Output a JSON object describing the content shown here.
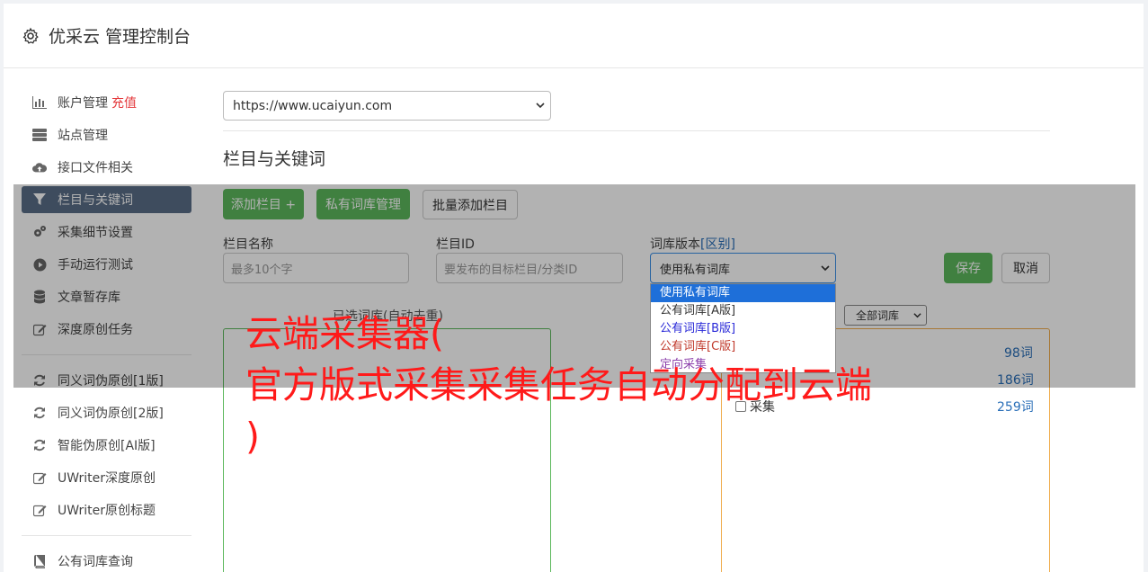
{
  "header": {
    "title": "优采云 管理控制台",
    "icon": "gear-icon"
  },
  "sidebar": {
    "items": [
      {
        "label": "账户管理",
        "badge": "充值",
        "icon": "bar-chart-icon"
      },
      {
        "label": "站点管理",
        "icon": "server-icon"
      },
      {
        "label": "接口文件相关",
        "icon": "cloud-upload-icon"
      },
      {
        "label": "栏目与关键词",
        "icon": "filter-icon",
        "active": true
      },
      {
        "label": "采集细节设置",
        "icon": "gears-icon"
      },
      {
        "label": "手动运行测试",
        "icon": "play-circle-icon"
      },
      {
        "label": "文章暂存库",
        "icon": "database-icon"
      },
      {
        "label": "深度原创任务",
        "icon": "edit-icon"
      },
      {
        "label": "同义词伪原创[1版]",
        "icon": "refresh-icon"
      },
      {
        "label": "同义词伪原创[2版]",
        "icon": "refresh-icon"
      },
      {
        "label": "智能伪原创[AI版]",
        "icon": "refresh-icon"
      },
      {
        "label": "UWriter深度原创",
        "icon": "edit-icon"
      },
      {
        "label": "UWriter原创标题",
        "icon": "edit-icon"
      },
      {
        "label": "公有词库查询",
        "icon": "book-icon"
      }
    ]
  },
  "site_select": {
    "value": "https://www.ucaiyun.com"
  },
  "section_title": "栏目与关键词",
  "toolbar": {
    "add_column": "添加栏目 +",
    "private_lib": "私有词库管理",
    "batch_add": "批量添加栏目"
  },
  "form": {
    "name_label": "栏目名称",
    "name_placeholder": "最多10个字",
    "id_label": "栏目ID",
    "id_placeholder": "要发布的目标栏目/分类ID",
    "lib_label": "词库版本",
    "lib_label_link": "[区别]",
    "lib_value": "使用私有词库",
    "save": "保存",
    "cancel": "取消"
  },
  "dropdown": {
    "options": [
      {
        "label": "使用私有词库",
        "color": "#ffffff",
        "selected": true
      },
      {
        "label": "公有词库[A版]",
        "color": "#333333"
      },
      {
        "label": "公有词库[B版]",
        "color": "#2a2ad8"
      },
      {
        "label": "公有词库[C版]",
        "color": "#c0392b"
      },
      {
        "label": "定向采集",
        "color": "#8e44ad"
      }
    ]
  },
  "panes": {
    "left_label": "已选词库(自动去重)",
    "right_filter": "全部词库",
    "right_label": "采集",
    "rows": [
      {
        "name": "",
        "count": "98词"
      },
      {
        "name": "",
        "count": "186词"
      },
      {
        "name": "采集",
        "count": "259词"
      }
    ]
  },
  "watermark": {
    "line1": "云端采集器(",
    "line2": "官方版式采集采集任务自动分配到云端",
    "line3": ")"
  },
  "colors": {
    "accent_green": "#5cb85c",
    "active_nav": "#5a6d87",
    "watermark": "#ff1a1a"
  }
}
